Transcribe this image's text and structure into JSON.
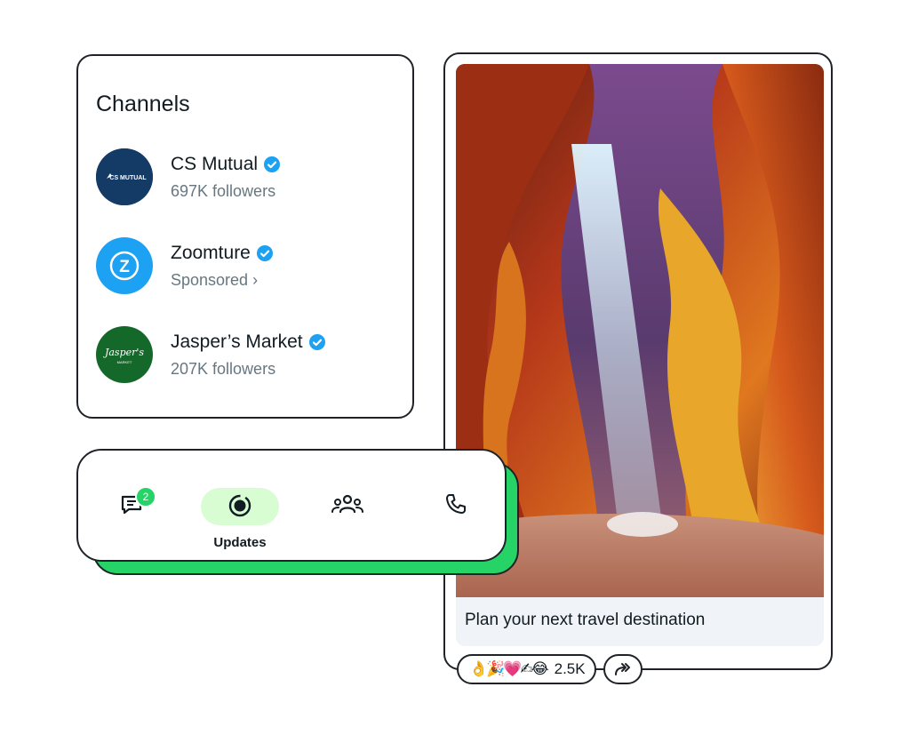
{
  "channels": {
    "title": "Channels",
    "items": [
      {
        "name": "CS Mutual",
        "subtitle": "697K followers",
        "avatar_text": "CS MUTUAL",
        "avatar_color": "#143a66"
      },
      {
        "name": "Zoomture",
        "subtitle": "Sponsored ›",
        "avatar_text": "Z",
        "avatar_color": "#1da1f2"
      },
      {
        "name": "Jasper’s Market",
        "subtitle": "207K followers",
        "avatar_text": "Jasper's",
        "avatar_subtext": "MARKET",
        "avatar_color": "#14682a"
      }
    ]
  },
  "nav": {
    "chats_badge": "2",
    "updates_label": "Updates",
    "icons": [
      "chats-icon",
      "updates-icon",
      "communities-icon",
      "calls-icon"
    ],
    "accent": "#25d366",
    "active_pill": "#d9fdd3"
  },
  "post": {
    "caption": "Plan your next travel destination",
    "reactions": "👌🎉💗✍😂",
    "reaction_count": "2.5K"
  }
}
